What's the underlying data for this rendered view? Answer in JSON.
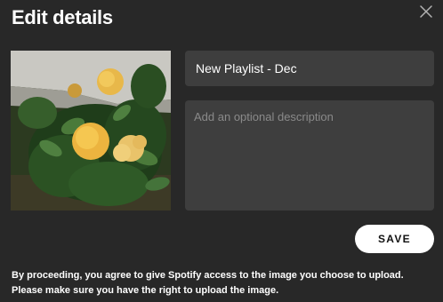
{
  "dialog": {
    "title": "Edit details",
    "close_icon": "close-icon",
    "cover_image": "playlist-cover-image",
    "name_value": "New Playlist - Dec",
    "description_placeholder": "Add an optional description",
    "save_label": "SAVE",
    "disclaimer": "By proceeding, you agree to give Spotify access to the image you choose to upload. Please make sure you have the right to upload the image."
  },
  "colors": {
    "background": "#282828",
    "input_background": "#3e3e3e",
    "button_background": "#ffffff",
    "button_text": "#111111",
    "placeholder": "#8a8a8a"
  }
}
